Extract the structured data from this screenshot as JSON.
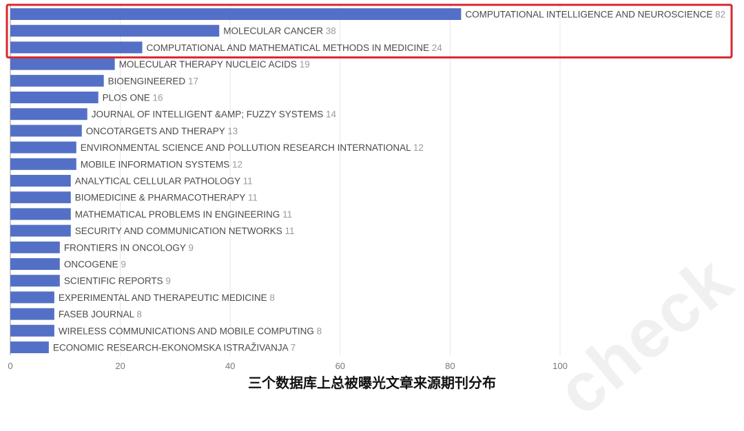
{
  "caption": "三个数据库上总被曝光文章来源期刊分布",
  "watermark": "check",
  "colors": {
    "bar": "#5470c6",
    "highlight": "#d9262c",
    "grid": "#e6e6e6",
    "axis": "#999999"
  },
  "chart_data": {
    "type": "bar",
    "orientation": "horizontal",
    "xlim": [
      0,
      100
    ],
    "xticks": [
      0,
      20,
      40,
      60,
      80,
      100
    ],
    "grid": true,
    "highlighted_categories": [
      0,
      1,
      2
    ],
    "categories": [
      "COMPUTATIONAL INTELLIGENCE AND NEUROSCIENCE",
      "MOLECULAR CANCER",
      "COMPUTATIONAL AND MATHEMATICAL METHODS IN MEDICINE",
      "MOLECULAR THERAPY NUCLEIC ACIDS",
      "BIOENGINEERED",
      "PLOS ONE",
      "JOURNAL OF INTELLIGENT &AMP; FUZZY SYSTEMS",
      "ONCOTARGETS AND THERAPY",
      "ENVIRONMENTAL SCIENCE AND POLLUTION RESEARCH INTERNATIONAL",
      "MOBILE INFORMATION SYSTEMS",
      "ANALYTICAL CELLULAR PATHOLOGY",
      "BIOMEDICINE & PHARMACOTHERAPY",
      "MATHEMATICAL PROBLEMS IN ENGINEERING",
      "SECURITY AND COMMUNICATION NETWORKS",
      "FRONTIERS IN ONCOLOGY",
      "ONCOGENE",
      "SCIENTIFIC REPORTS",
      "EXPERIMENTAL AND THERAPEUTIC MEDICINE",
      "FASEB JOURNAL",
      "WIRELESS COMMUNICATIONS AND MOBILE COMPUTING",
      "ECONOMIC RESEARCH-EKONOMSKA ISTRAŽIVANJA"
    ],
    "values": [
      82,
      38,
      24,
      19,
      17,
      16,
      14,
      13,
      12,
      12,
      11,
      11,
      11,
      11,
      9,
      9,
      9,
      8,
      8,
      8,
      7
    ]
  }
}
